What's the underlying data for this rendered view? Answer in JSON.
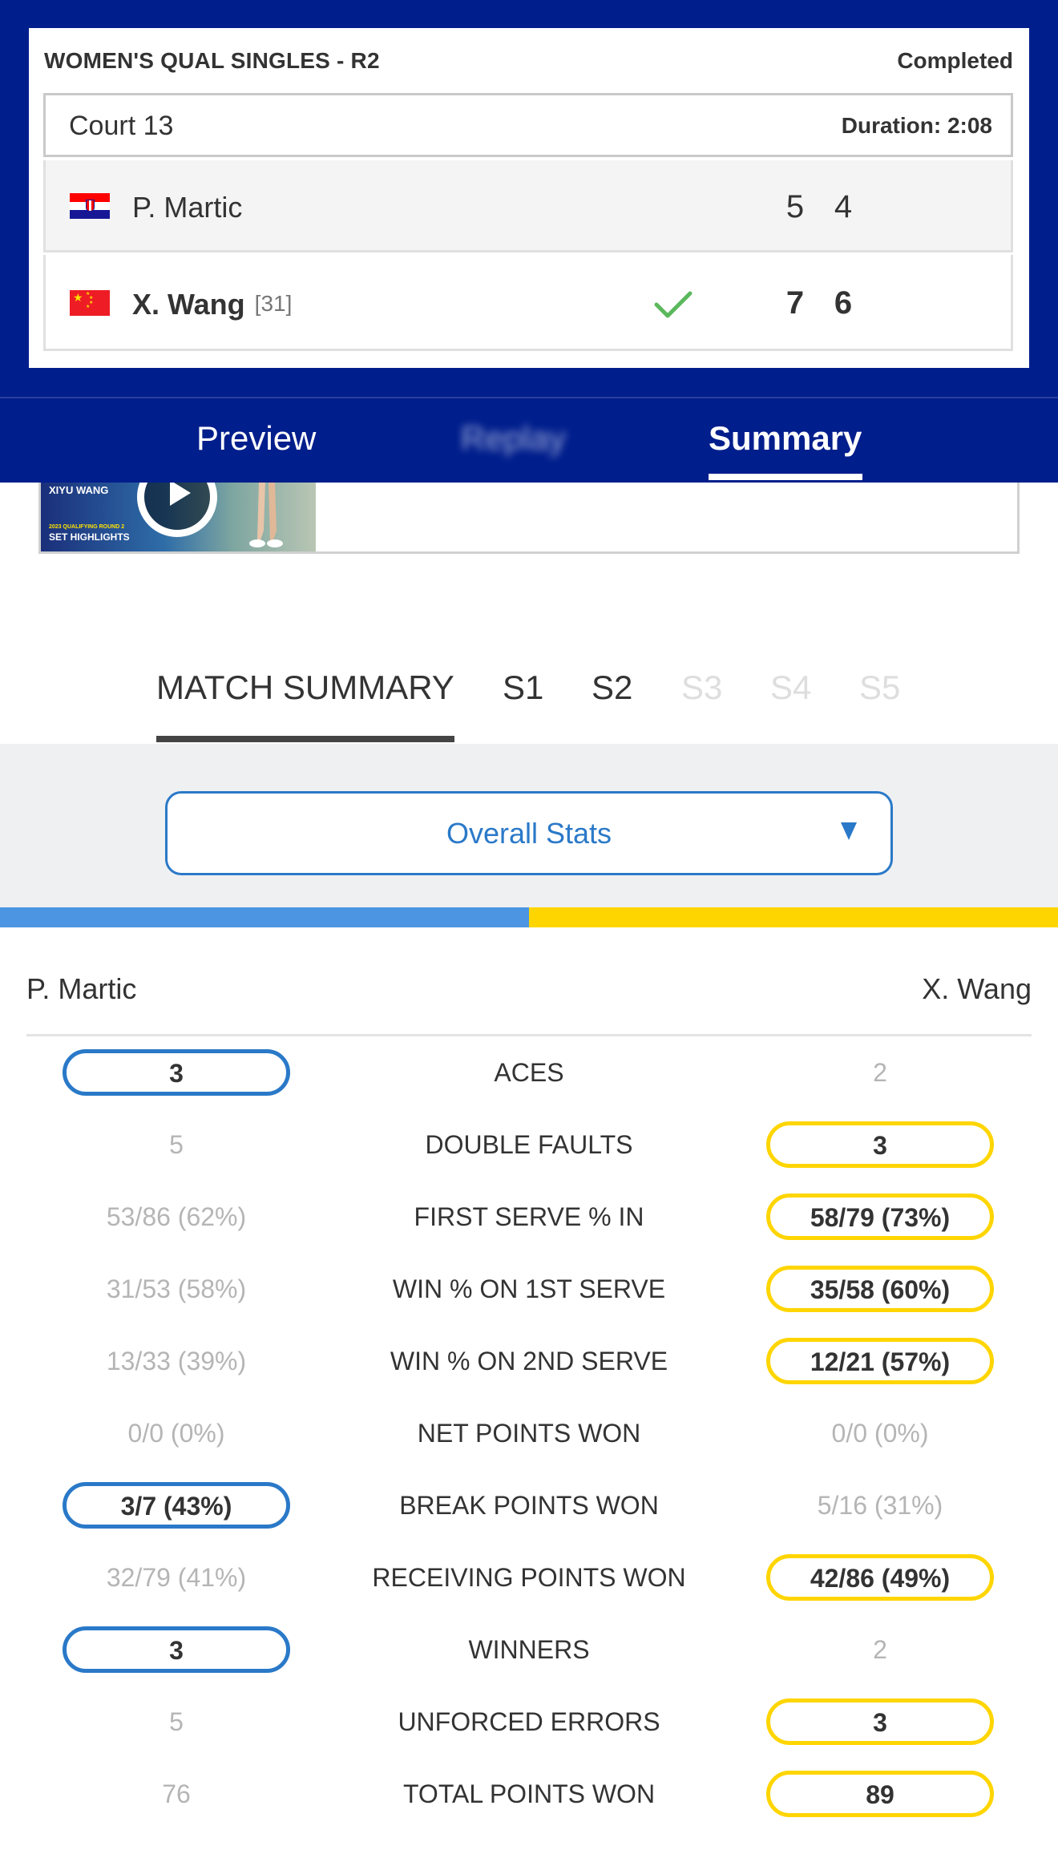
{
  "match": {
    "round": "WOMEN'S QUAL SINGLES - R2",
    "status": "Completed",
    "court": "Court 13",
    "duration": "Duration: 2:08",
    "players": [
      {
        "name": "P. Martic",
        "country_flag": "croatia-flag",
        "seed": "",
        "sets": [
          "5",
          "4"
        ],
        "winner": false
      },
      {
        "name": "X. Wang",
        "country_flag": "china-flag",
        "seed": "[31]",
        "sets": [
          "7",
          "6"
        ],
        "winner": true
      }
    ]
  },
  "tabs": [
    {
      "label": "Preview",
      "active": false
    },
    {
      "label": "Replay",
      "active": false
    },
    {
      "label": "Summary",
      "active": true
    }
  ],
  "video": {
    "thumbnail_name": "XIYU WANG",
    "thumbnail_subtitle": "2023 QUALIFYING ROUND 2",
    "thumbnail_tag": "SET HIGHLIGHTS"
  },
  "summary_tabs": [
    {
      "label": "MATCH SUMMARY",
      "active": true,
      "enabled": true
    },
    {
      "label": "S1",
      "enabled": true
    },
    {
      "label": "S2",
      "enabled": true
    },
    {
      "label": "S3",
      "enabled": false
    },
    {
      "label": "S4",
      "enabled": false
    },
    {
      "label": "S5",
      "enabled": false
    }
  ],
  "stats_filter": {
    "selected": "Overall Stats"
  },
  "colors": {
    "brand_blue": "#001e8c",
    "p1_accent": "#2a79c8",
    "p2_accent": "#ffd500",
    "winner_check": "#5cb85c"
  },
  "stats": {
    "player1": "P. Martic",
    "player2": "X. Wang",
    "rows": [
      {
        "label": "ACES",
        "p1": "3",
        "p2": "2",
        "leader": "p1"
      },
      {
        "label": "DOUBLE FAULTS",
        "p1": "5",
        "p2": "3",
        "leader": "p2"
      },
      {
        "label": "FIRST SERVE % IN",
        "p1": "53/86 (62%)",
        "p2": "58/79 (73%)",
        "leader": "p2"
      },
      {
        "label": "WIN % ON 1ST SERVE",
        "p1": "31/53 (58%)",
        "p2": "35/58 (60%)",
        "leader": "p2"
      },
      {
        "label": "WIN % ON 2ND SERVE",
        "p1": "13/33 (39%)",
        "p2": "12/21 (57%)",
        "leader": "p2"
      },
      {
        "label": "NET POINTS WON",
        "p1": "0/0 (0%)",
        "p2": "0/0 (0%)",
        "leader": "none"
      },
      {
        "label": "BREAK POINTS WON",
        "p1": "3/7 (43%)",
        "p2": "5/16 (31%)",
        "leader": "p1"
      },
      {
        "label": "RECEIVING POINTS WON",
        "p1": "32/79 (41%)",
        "p2": "42/86 (49%)",
        "leader": "p2"
      },
      {
        "label": "WINNERS",
        "p1": "3",
        "p2": "2",
        "leader": "p1"
      },
      {
        "label": "UNFORCED ERRORS",
        "p1": "5",
        "p2": "3",
        "leader": "p2"
      },
      {
        "label": "TOTAL POINTS WON",
        "p1": "76",
        "p2": "89",
        "leader": "p2"
      }
    ]
  }
}
